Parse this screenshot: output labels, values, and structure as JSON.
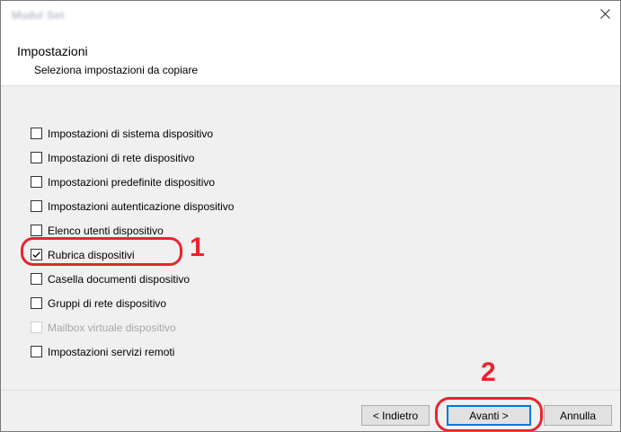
{
  "window": {
    "title": "Mudul Set",
    "close_icon": "close-icon"
  },
  "header": {
    "title": "Impostazioni",
    "subtitle": "Seleziona impostazioni da copiare"
  },
  "options": [
    {
      "label": "Impostazioni di sistema dispositivo",
      "checked": false,
      "enabled": true
    },
    {
      "label": "Impostazioni di rete dispositivo",
      "checked": false,
      "enabled": true
    },
    {
      "label": "Impostazioni predefinite dispositivo",
      "checked": false,
      "enabled": true
    },
    {
      "label": "Impostazioni autenticazione dispositivo",
      "checked": false,
      "enabled": true
    },
    {
      "label": "Elenco utenti dispositivo",
      "checked": false,
      "enabled": true
    },
    {
      "label": "Rubrica dispositivi",
      "checked": true,
      "enabled": true
    },
    {
      "label": "Casella documenti dispositivo",
      "checked": false,
      "enabled": true
    },
    {
      "label": "Gruppi di rete dispositivo",
      "checked": false,
      "enabled": true
    },
    {
      "label": "Mailbox virtuale dispositivo",
      "checked": false,
      "enabled": false
    },
    {
      "label": "Impostazioni servizi remoti",
      "checked": false,
      "enabled": true
    }
  ],
  "annotations": {
    "step1": "1",
    "step2": "2",
    "color": "#e8242f"
  },
  "footer": {
    "back_label": "< Indietro",
    "next_label": "Avanti >",
    "cancel_label": "Annulla"
  },
  "colors": {
    "accent": "#0078d7",
    "dialog_bg": "#f0f0f0",
    "annotation": "#e8242f"
  }
}
